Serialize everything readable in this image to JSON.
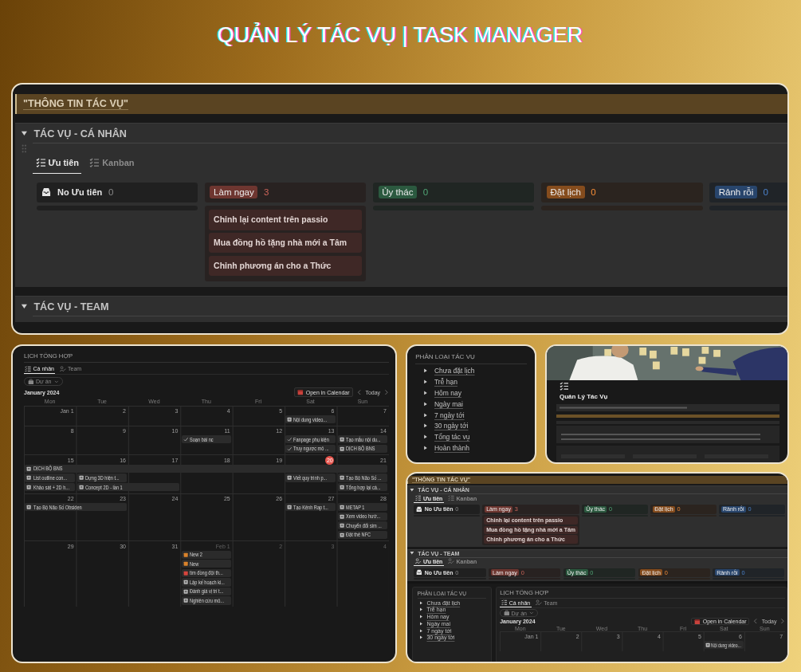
{
  "title": "QUẢN LÝ TÁC VỤ | TASK MANAGER",
  "top_panel": {
    "banner": "\"THÔNG TIN TÁC VỤ\"",
    "sections": [
      {
        "title": "TÁC VỤ - CÁ NHÂN",
        "tabs": [
          {
            "label": "Ưu tiên",
            "kind": "list",
            "selected": true
          },
          {
            "label": "Kanban",
            "kind": "list",
            "selected": false
          }
        ],
        "columns": [
          {
            "kind": "plain",
            "label": "No Ưu tiên",
            "count": "0"
          },
          {
            "kind": "tag",
            "label": "Làm ngay",
            "count": "3",
            "color": "#6e3630",
            "cards": [
              "Chỉnh lại content trên passio",
              "Mua đồng hồ tặng nhà mới a Tâm",
              "Chỉnh phương án cho a Thức"
            ]
          },
          {
            "kind": "tag",
            "label": "Ủy thác",
            "count": "0",
            "color": "#2b593f"
          },
          {
            "kind": "tag",
            "label": "Đặt lịch",
            "count": "0",
            "color": "#854c1d"
          },
          {
            "kind": "tag",
            "label": "Rảnh rỗi",
            "count": "0",
            "color": "#28456c"
          }
        ]
      },
      {
        "title": "TÁC VỤ - TEAM"
      }
    ]
  },
  "calendar_panel": {
    "title": "LỊCH TỔNG HỢP",
    "tabs": [
      {
        "label": "Cá nhân",
        "kind": "list",
        "selected": true
      },
      {
        "label": "Team",
        "kind": "person",
        "selected": false
      }
    ],
    "filter": "Dự án",
    "month": "January 2024",
    "open_button": "Open in Calendar",
    "today_button": "Today",
    "weekdays": [
      "Mon",
      "Tue",
      "Wed",
      "Thu",
      "Fri",
      "Sat",
      "Sun"
    ],
    "weeks": [
      {
        "days": [
          {
            "label": "Jan 1",
            "today": false,
            "muted": false
          },
          {
            "label": "2",
            "today": false,
            "muted": false
          },
          {
            "label": "3",
            "today": false,
            "muted": false
          },
          {
            "label": "4",
            "today": false,
            "muted": false
          },
          {
            "label": "5",
            "today": false,
            "muted": false
          },
          {
            "label": "6",
            "today": false,
            "muted": false
          },
          {
            "label": "7",
            "today": false,
            "muted": false
          }
        ],
        "lanes": [
          [
            {
              "kind": "blank"
            },
            {
              "kind": "blank"
            },
            {
              "kind": "blank"
            },
            {
              "kind": "blank"
            },
            {
              "kind": "blank"
            },
            {
              "kind": "page",
              "text": "Nội dung video..."
            },
            {
              "kind": "blank"
            }
          ]
        ]
      },
      {
        "days": [
          {
            "label": "8",
            "today": false,
            "muted": false
          },
          {
            "label": "9",
            "today": false,
            "muted": false
          },
          {
            "label": "10",
            "today": false,
            "muted": false
          },
          {
            "label": "11",
            "today": false,
            "muted": false
          },
          {
            "label": "12",
            "today": false,
            "muted": false
          },
          {
            "label": "13",
            "today": false,
            "muted": false
          },
          {
            "label": "14",
            "today": false,
            "muted": false
          }
        ],
        "lanes": [
          [
            {
              "kind": "blank"
            },
            {
              "kind": "blank"
            },
            {
              "kind": "blank"
            },
            {
              "kind": "check",
              "text": "Soạn bài nc"
            },
            {
              "kind": "blank"
            },
            {
              "kind": "check",
              "text": "Fanpage phụ kiện"
            },
            {
              "kind": "page",
              "text": "Tạo mẫu nội du..."
            }
          ],
          [
            {
              "kind": "blank"
            },
            {
              "kind": "blank"
            },
            {
              "kind": "blank"
            },
            {
              "kind": "blank"
            },
            {
              "kind": "blank"
            },
            {
              "kind": "check",
              "text": "Truy ngược mô ..."
            },
            {
              "kind": "page",
              "text": "DỊCH BỘ BNS"
            }
          ]
        ]
      },
      {
        "days": [
          {
            "label": "15",
            "today": false,
            "muted": false
          },
          {
            "label": "16",
            "today": false,
            "muted": false
          },
          {
            "label": "17",
            "today": false,
            "muted": false
          },
          {
            "label": "18",
            "today": false,
            "muted": false
          },
          {
            "label": "19",
            "today": false,
            "muted": false
          },
          {
            "label": "20",
            "today": true,
            "muted": false
          },
          {
            "label": "21",
            "today": false,
            "muted": false
          }
        ],
        "lanes": [
          [
            {
              "kind": "page",
              "text": "DỊCH BỘ BNS"
            },
            {
              "kind": "continued"
            },
            {
              "kind": "continued"
            },
            {
              "kind": "continued"
            },
            {
              "kind": "continued"
            },
            {
              "kind": "continued"
            },
            {
              "kind": "continued"
            }
          ],
          [
            {
              "kind": "page",
              "text": "List outline con..."
            },
            {
              "kind": "page",
              "text": "Dựng 3D hiện t..."
            },
            {
              "kind": "blank"
            },
            {
              "kind": "blank"
            },
            {
              "kind": "blank"
            },
            {
              "kind": "page",
              "text": "Viết quy trình p..."
            },
            {
              "kind": "page",
              "text": "Tạo Bộ Não Số ..."
            }
          ],
          [
            {
              "kind": "page",
              "text": "Khảo sát + 2D h..."
            },
            {
              "kind": "page",
              "text": "Concept 2D - lần 1"
            },
            {
              "kind": "continued"
            },
            {
              "kind": "blank"
            },
            {
              "kind": "blank"
            },
            {
              "kind": "blank"
            },
            {
              "kind": "page",
              "text": "Tổng hợp lại cá..."
            }
          ]
        ]
      },
      {
        "days": [
          {
            "label": "22",
            "today": false,
            "muted": false
          },
          {
            "label": "23",
            "today": false,
            "muted": false
          },
          {
            "label": "24",
            "today": false,
            "muted": false
          },
          {
            "label": "25",
            "today": false,
            "muted": false
          },
          {
            "label": "26",
            "today": false,
            "muted": false
          },
          {
            "label": "27",
            "today": false,
            "muted": false
          },
          {
            "label": "28",
            "today": false,
            "muted": false
          }
        ],
        "lanes": [
          [
            {
              "kind": "page",
              "text": "Tạo Bộ Não Số Obsiden"
            },
            {
              "kind": "continued"
            },
            {
              "kind": "blank"
            },
            {
              "kind": "blank"
            },
            {
              "kind": "blank"
            },
            {
              "kind": "page",
              "text": "Tạo Kênh Rap t..."
            },
            {
              "kind": "page",
              "text": "METAP 1"
            }
          ],
          [
            {
              "kind": "blank"
            },
            {
              "kind": "blank"
            },
            {
              "kind": "blank"
            },
            {
              "kind": "blank"
            },
            {
              "kind": "blank"
            },
            {
              "kind": "blank"
            },
            {
              "kind": "page",
              "text": "Xem video hướ..."
            }
          ],
          [
            {
              "kind": "blank"
            },
            {
              "kind": "blank"
            },
            {
              "kind": "blank"
            },
            {
              "kind": "blank"
            },
            {
              "kind": "blank"
            },
            {
              "kind": "blank"
            },
            {
              "kind": "page",
              "text": "Chuyển đổi sim ..."
            }
          ],
          [
            {
              "kind": "blank"
            },
            {
              "kind": "blank"
            },
            {
              "kind": "blank"
            },
            {
              "kind": "blank"
            },
            {
              "kind": "blank"
            },
            {
              "kind": "blank"
            },
            {
              "kind": "page",
              "text": "Đặt thẻ NFC"
            }
          ]
        ]
      },
      {
        "days": [
          {
            "label": "29",
            "today": false,
            "muted": false
          },
          {
            "label": "30",
            "today": false,
            "muted": false
          },
          {
            "label": "31",
            "today": false,
            "muted": false
          },
          {
            "label": "Feb 1",
            "today": false,
            "muted": true
          },
          {
            "label": "2",
            "today": false,
            "muted": true
          },
          {
            "label": "3",
            "today": false,
            "muted": true
          },
          {
            "label": "4",
            "today": false,
            "muted": true
          }
        ],
        "lanes": [
          [
            {
              "kind": "blank"
            },
            {
              "kind": "blank"
            },
            {
              "kind": "blank"
            },
            {
              "kind": "square",
              "color": "#d9822b",
              "text": "New 2"
            },
            {
              "kind": "blank"
            },
            {
              "kind": "blank"
            },
            {
              "kind": "blank"
            }
          ],
          [
            {
              "kind": "blank"
            },
            {
              "kind": "blank"
            },
            {
              "kind": "blank"
            },
            {
              "kind": "square",
              "color": "#d9822b",
              "text": "New"
            },
            {
              "kind": "blank"
            },
            {
              "kind": "blank"
            },
            {
              "kind": "blank"
            }
          ],
          [
            {
              "kind": "blank"
            },
            {
              "kind": "blank"
            },
            {
              "kind": "blank"
            },
            {
              "kind": "square",
              "color": "#d6453d",
              "text": "tìm đồng đội th..."
            },
            {
              "kind": "blank"
            },
            {
              "kind": "blank"
            },
            {
              "kind": "blank"
            }
          ],
          [
            {
              "kind": "blank"
            },
            {
              "kind": "blank"
            },
            {
              "kind": "blank"
            },
            {
              "kind": "page",
              "text": "Lập kế hoạch ki..."
            },
            {
              "kind": "blank"
            },
            {
              "kind": "blank"
            },
            {
              "kind": "blank"
            }
          ],
          [
            {
              "kind": "blank"
            },
            {
              "kind": "blank"
            },
            {
              "kind": "blank"
            },
            {
              "kind": "page",
              "text": "Đánh giá vị trí t..."
            },
            {
              "kind": "blank"
            },
            {
              "kind": "blank"
            },
            {
              "kind": "blank"
            }
          ],
          [
            {
              "kind": "blank"
            },
            {
              "kind": "blank"
            },
            {
              "kind": "blank"
            },
            {
              "kind": "page",
              "text": "Nghiên cứu mô..."
            },
            {
              "kind": "blank"
            },
            {
              "kind": "blank"
            },
            {
              "kind": "blank"
            }
          ]
        ]
      }
    ]
  },
  "category_panel": {
    "title": "PHÂN LOẠI TÁC VỤ",
    "items": [
      "Chưa đặt lịch",
      "Trễ hạn",
      "Hôm nay",
      "Ngày mai",
      "7 ngày tới",
      "30 ngày tới",
      "Tổng tác vụ",
      "Hoàn thành"
    ]
  },
  "preview_panel": {
    "kind": "picture",
    "title": "Quản Lý Tác Vụ"
  },
  "mini_panel": {
    "banner": "\"THÔNG TIN TÁC VỤ\"",
    "sections": [
      {
        "title": "TÁC VỤ - CÁ NHÂN",
        "tabs": [
          {
            "label": "Ưu tiên",
            "kind": "list",
            "selected": true
          },
          {
            "label": "Kanban",
            "kind": "list",
            "selected": false
          }
        ],
        "columns": [
          {
            "kind": "plain",
            "label": "No Ưu tiên",
            "count": "0"
          },
          {
            "kind": "tag",
            "label": "Làm ngay",
            "count": "3",
            "color": "#6e3630",
            "cards": [
              "Chỉnh lại content trên passio",
              "Mua đồng hồ tặng nhà mới a Tâm",
              "Chỉnh phương án cho a Thức"
            ]
          },
          {
            "kind": "tag",
            "label": "Ủy thác",
            "count": "0",
            "color": "#2b593f"
          },
          {
            "kind": "tag",
            "label": "Đặt lịch",
            "count": "0",
            "color": "#854c1d"
          },
          {
            "kind": "tag",
            "label": "Rảnh rỗi",
            "count": "0",
            "color": "#28456c"
          }
        ]
      },
      {
        "title": "TÁC VỤ - TEAM",
        "tabs": [
          {
            "label": "Ưu tiên",
            "kind": "person",
            "selected": true
          },
          {
            "label": "Kanban",
            "kind": "person",
            "selected": false
          }
        ],
        "columns": [
          {
            "kind": "plain",
            "label": "No Ưu tiên",
            "count": "0"
          },
          {
            "kind": "tag",
            "label": "Làm ngay",
            "count": "0",
            "color": "#6e3630"
          },
          {
            "kind": "tag",
            "label": "Ủy thác",
            "count": "0",
            "color": "#2b593f"
          },
          {
            "kind": "tag",
            "label": "Đặt lịch",
            "count": "0",
            "color": "#854c1d"
          },
          {
            "kind": "tag",
            "label": "Rảnh rỗi",
            "count": "0",
            "color": "#28456c"
          }
        ]
      }
    ],
    "category": {
      "title": "PHÂN LOẠI TÁC VỤ",
      "items": [
        "Chưa đặt lịch",
        "Trễ hạn",
        "Hôm nay",
        "Ngày mai",
        "7 ngày tới",
        "30 ngày tới"
      ]
    },
    "calendar": {
      "title": "LỊCH TỔNG HỢP",
      "tabs": [
        {
          "label": "Cá nhân",
          "kind": "list",
          "selected": true
        },
        {
          "label": "Team",
          "kind": "person",
          "selected": false
        }
      ],
      "filter": "Dự án",
      "month": "January 2024",
      "open_button": "Open in Calendar",
      "today_button": "Today",
      "weekdays": [
        "Mon",
        "Tue",
        "Wed",
        "Thu",
        "Fri",
        "Sat",
        "Sun"
      ],
      "weeks": [
        {
          "days": [
            {
              "label": "Jan 1",
              "today": false,
              "muted": false
            },
            {
              "label": "2",
              "today": false,
              "muted": false
            },
            {
              "label": "3",
              "today": false,
              "muted": false
            },
            {
              "label": "4",
              "today": false,
              "muted": false
            },
            {
              "label": "5",
              "today": false,
              "muted": false
            },
            {
              "label": "6",
              "today": false,
              "muted": false
            },
            {
              "label": "7",
              "today": false,
              "muted": false
            }
          ],
          "lanes": [
            [
              {
                "kind": "blank"
              },
              {
                "kind": "blank"
              },
              {
                "kind": "blank"
              },
              {
                "kind": "blank"
              },
              {
                "kind": "blank"
              },
              {
                "kind": "page",
                "text": "Nội dung video..."
              },
              {
                "kind": "blank"
              }
            ]
          ]
        }
      ]
    }
  }
}
